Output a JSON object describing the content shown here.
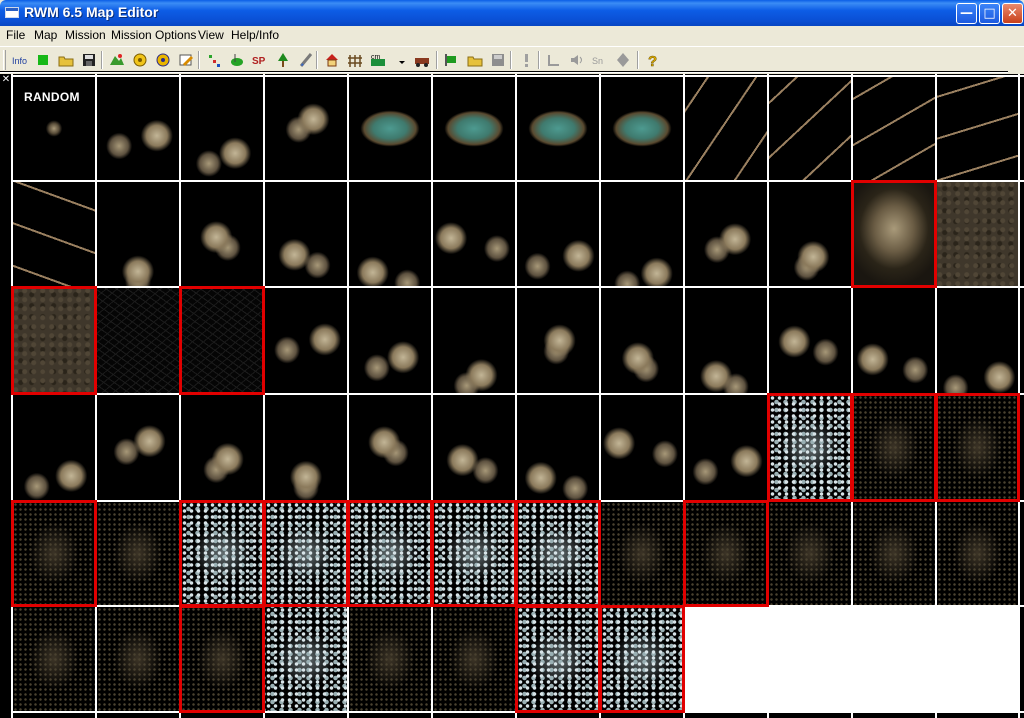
{
  "window": {
    "title": "RWM 6.5 Map Editor"
  },
  "menu": [
    {
      "label": "File"
    },
    {
      "label": "Map"
    },
    {
      "label": "Mission"
    },
    {
      "label": "Mission Options"
    },
    {
      "label": "View"
    },
    {
      "label": "Help/Info"
    }
  ],
  "toolbar": [
    {
      "name": "info-icon"
    },
    {
      "name": "new-map-icon"
    },
    {
      "name": "open-folder-icon"
    },
    {
      "name": "save-icon"
    },
    {
      "name": "terrain-tool-icon"
    },
    {
      "name": "gear-tool-icon"
    },
    {
      "name": "gear-tool-2-icon"
    },
    {
      "name": "edit-tool-icon"
    },
    {
      "name": "unit-tool-icon"
    },
    {
      "name": "green-blob-icon"
    },
    {
      "name": "sp-icon"
    },
    {
      "name": "tree-icon"
    },
    {
      "name": "brush-icon"
    },
    {
      "name": "house-icon"
    },
    {
      "name": "fence-icon"
    },
    {
      "name": "cm-icon"
    },
    {
      "name": "dropdown-arrow-icon"
    },
    {
      "name": "train-icon"
    },
    {
      "name": "green-flag-icon"
    },
    {
      "name": "folder-2-icon"
    },
    {
      "name": "disk-gray-icon"
    },
    {
      "name": "exclamation-icon"
    },
    {
      "name": "layers-gray-icon"
    },
    {
      "name": "speaker-gray-icon"
    },
    {
      "name": "sound-gray-icon"
    },
    {
      "name": "diamond-gray-icon"
    },
    {
      "name": "help-question-icon"
    }
  ],
  "palette": {
    "random_label": "RANDOM",
    "colors": {
      "selection": "#e10000",
      "grid": "#ffffff",
      "empty_cell": "#ffffff"
    },
    "rows": [
      [
        "random",
        "rock",
        "rock",
        "rock",
        "water",
        "water",
        "water",
        "water",
        "twigs",
        "twigs",
        "twigs",
        "twigs"
      ],
      [
        "twigs",
        "rock",
        "rock",
        "rock",
        "rock",
        "rock",
        "rock",
        "rock",
        "rock",
        "rock",
        "cliff",
        "ground"
      ],
      [
        "ground",
        "mesh",
        "mesh",
        "rock",
        "rock",
        "rock",
        "rock",
        "rock",
        "rock",
        "rock",
        "rock",
        "rock"
      ],
      [
        "rock",
        "rock",
        "rock",
        "rock",
        "rock",
        "rock",
        "rock",
        "rock",
        "rock",
        "snow",
        "dust",
        "dust"
      ],
      [
        "dust",
        "dust",
        "snow",
        "snow",
        "snow",
        "snow",
        "snow",
        "dust",
        "dust",
        "dust",
        "dust",
        "dust"
      ],
      [
        "dust",
        "dust",
        "dust",
        "snow",
        "dust",
        "dust",
        "snow",
        "snow",
        "empty",
        "empty",
        "empty",
        "empty"
      ]
    ],
    "selected_cells": [
      "1-10",
      "2-0",
      "2-2",
      "3-9",
      "3-10",
      "3-11",
      "4-0",
      "4-2",
      "4-3",
      "4-4",
      "4-5",
      "4-6",
      "4-8",
      "5-2",
      "5-6",
      "5-7"
    ]
  }
}
